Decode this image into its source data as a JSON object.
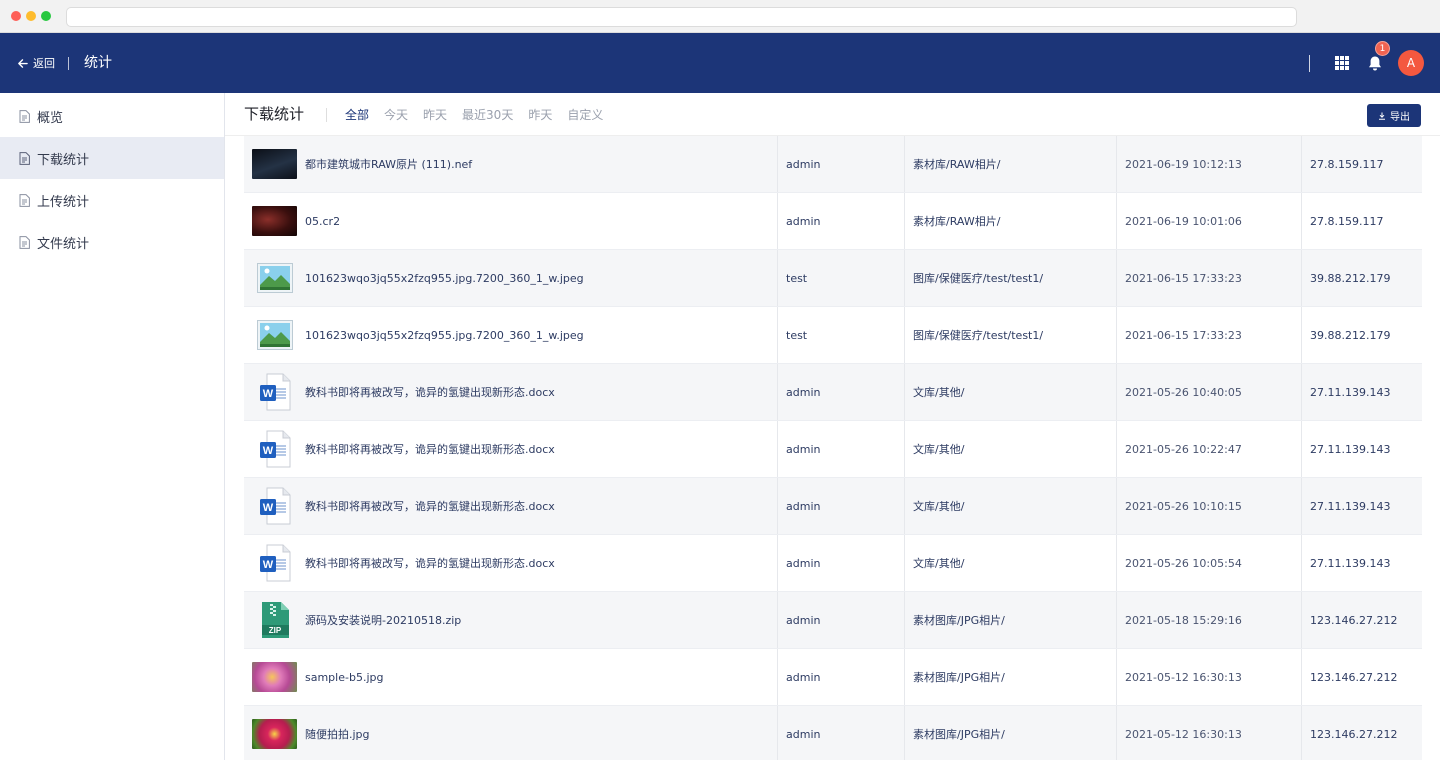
{
  "header": {
    "back_label": "返回",
    "title": "统计",
    "notification_count": "1",
    "avatar_letter": "A",
    "brand_color": "#1c3578"
  },
  "sidebar": {
    "items": [
      {
        "label": "概览",
        "active": false
      },
      {
        "label": "下载统计",
        "active": true
      },
      {
        "label": "上传统计",
        "active": false
      },
      {
        "label": "文件统计",
        "active": false
      }
    ]
  },
  "main": {
    "title": "下载统计",
    "filters": [
      "全部",
      "今天",
      "昨天",
      "最近30天",
      "昨天",
      "自定义"
    ],
    "active_filter": "全部",
    "export_label": "导出"
  },
  "rows": [
    {
      "thumb": "image-night-city",
      "name": "都市建筑城市RAW原片 (111).nef",
      "user": "admin",
      "path": "素材库/RAW相片/",
      "time": "2021-06-19 10:12:13",
      "ip": "27.8.159.117"
    },
    {
      "thumb": "image-portrait",
      "name": "05.cr2",
      "user": "admin",
      "path": "素材库/RAW相片/",
      "time": "2021-06-19 10:01:06",
      "ip": "27.8.159.117"
    },
    {
      "thumb": "image-generic-icon",
      "name": "101623wqo3jq55x2fzq955.jpg.7200_360_1_w.jpeg",
      "user": "test",
      "path": "图库/保健医疗/test/test1/",
      "time": "2021-06-15 17:33:23",
      "ip": "39.88.212.179"
    },
    {
      "thumb": "image-generic-icon",
      "name": "101623wqo3jq55x2fzq955.jpg.7200_360_1_w.jpeg",
      "user": "test",
      "path": "图库/保健医疗/test/test1/",
      "time": "2021-06-15 17:33:23",
      "ip": "39.88.212.179"
    },
    {
      "thumb": "word-doc-icon",
      "name": "教科书即将再被改写，诡异的氢键出现新形态.docx",
      "user": "admin",
      "path": "文库/其他/",
      "time": "2021-05-26 10:40:05",
      "ip": "27.11.139.143"
    },
    {
      "thumb": "word-doc-icon",
      "name": "教科书即将再被改写，诡异的氢键出现新形态.docx",
      "user": "admin",
      "path": "文库/其他/",
      "time": "2021-05-26 10:22:47",
      "ip": "27.11.139.143"
    },
    {
      "thumb": "word-doc-icon",
      "name": "教科书即将再被改写，诡异的氢键出现新形态.docx",
      "user": "admin",
      "path": "文库/其他/",
      "time": "2021-05-26 10:10:15",
      "ip": "27.11.139.143"
    },
    {
      "thumb": "word-doc-icon",
      "name": "教科书即将再被改写，诡异的氢键出现新形态.docx",
      "user": "admin",
      "path": "文库/其他/",
      "time": "2021-05-26 10:05:54",
      "ip": "27.11.139.143"
    },
    {
      "thumb": "zip-file-icon",
      "name": "源码及安装说明-20210518.zip",
      "user": "admin",
      "path": "素材图库/JPG相片/",
      "time": "2021-05-18 15:29:16",
      "ip": "123.146.27.212"
    },
    {
      "thumb": "image-pink-flower",
      "name": "sample-b5.jpg",
      "user": "admin",
      "path": "素材图库/JPG相片/",
      "time": "2021-05-12 16:30:13",
      "ip": "123.146.27.212"
    },
    {
      "thumb": "image-magenta-flower",
      "name": "随便拍拍.jpg",
      "user": "admin",
      "path": "素材图库/JPG相片/",
      "time": "2021-05-12 16:30:13",
      "ip": "123.146.27.212"
    }
  ]
}
